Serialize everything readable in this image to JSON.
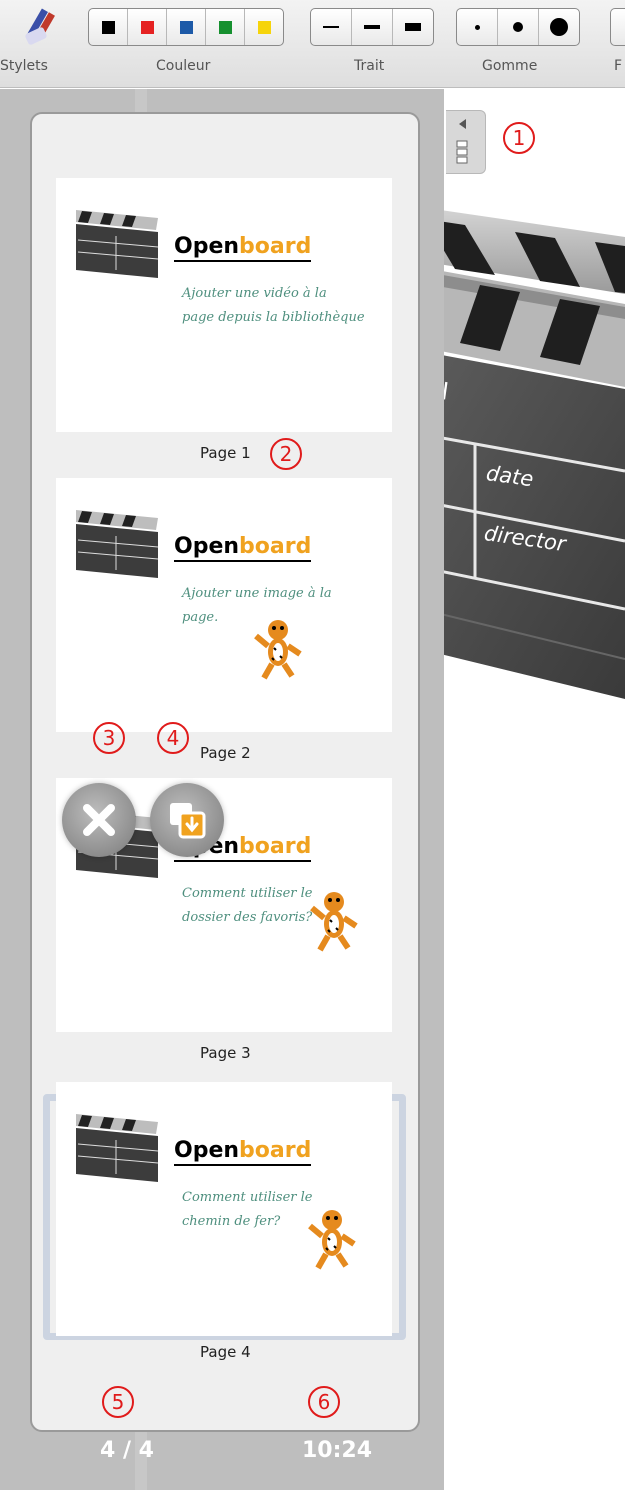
{
  "toolbar": {
    "groups": [
      {
        "label": "Stylets",
        "icon": "pen-eraser-icon"
      },
      {
        "label": "Couleur",
        "colors": [
          "#000000",
          "#e52222",
          "#1d5aa8",
          "#16902f",
          "#f6d40b"
        ]
      },
      {
        "label": "Trait",
        "options": [
          "thin",
          "medium",
          "thick"
        ]
      },
      {
        "label": "Gomme",
        "options": [
          "small",
          "medium",
          "large"
        ]
      },
      {
        "label": "F"
      }
    ]
  },
  "sidebar": {
    "collapse_icon": "collapse-left-icon",
    "pages": [
      {
        "label": "Page 1",
        "logo_open": "Open",
        "logo_board": "board",
        "text_line1": "Ajouter une vidéo à la",
        "text_line2": "page depuis la bibliothèque",
        "has_tiger": false
      },
      {
        "label": "Page 2",
        "logo_open": "Open",
        "logo_board": "board",
        "text_line1": "Ajouter une image à la",
        "text_line2": "page.",
        "has_tiger": true
      },
      {
        "label": "Page 3",
        "logo_open": "Open",
        "logo_board": "board",
        "text_line1": "Comment utiliser le",
        "text_line2": "dossier des favoris?",
        "has_tiger": true
      },
      {
        "label": "Page 4",
        "logo_open": "Open",
        "logo_board": "board",
        "text_line1": "Comment utiliser le",
        "text_line2": "chemin de fer?",
        "has_tiger": true,
        "selected": true
      }
    ],
    "actions": {
      "delete_icon": "delete-page-icon",
      "duplicate_icon": "duplicate-page-icon"
    },
    "page_counter": "4 / 4",
    "clock": "10:24"
  },
  "callouts": [
    "1",
    "2",
    "3",
    "4",
    "5",
    "6"
  ],
  "board": {
    "clapper_texts": [
      "ON",
      "date",
      "director"
    ]
  }
}
